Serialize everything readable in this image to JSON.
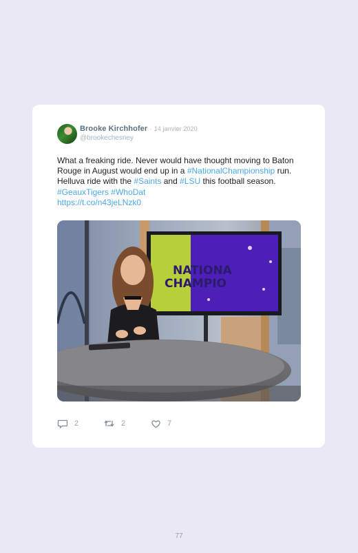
{
  "tweet": {
    "author_name": "Brooke Kirchhofer",
    "separator": "·",
    "date": "14 janvier 2020",
    "handle": "@brookechesney",
    "text_parts": {
      "t1": "What a freaking ride. Never would have thought moving to Baton Rouge in August would end up in a ",
      "h1": "#NationalChampionship",
      "t2": " run. Helluva ride with the ",
      "h2": "#Saints",
      "t3": " and ",
      "h3": "#LSU",
      "t4": " this football season. ",
      "h4": "#GeauxTigers",
      "t5": " ",
      "h5": "#WhoDat",
      "url": "https://t.co/n43jeLNzk0"
    },
    "media": {
      "screen_text_line1": "NATIONA",
      "screen_text_line2": "CHAMPIO"
    },
    "actions": {
      "replies": "2",
      "retweets": "2",
      "likes": "7"
    }
  },
  "page_number": "77",
  "colors": {
    "background": "#ebe8f5",
    "link": "#4aa8e8",
    "name": "#5b7183",
    "muted": "#a9b4bf"
  },
  "icons": [
    "reply-icon",
    "retweet-icon",
    "like-icon"
  ]
}
